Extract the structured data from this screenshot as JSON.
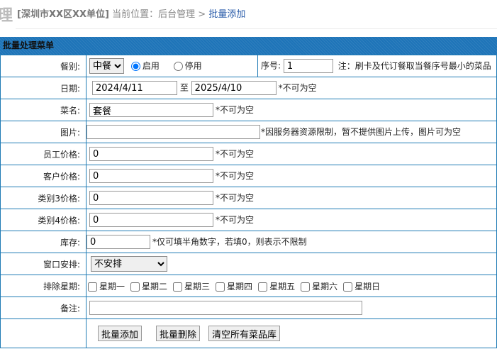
{
  "header": {
    "logo": "理",
    "org": "[深圳市XX区XX单位]",
    "location_label": "当前位置：",
    "path": "后台管理 >",
    "current": "批量添加"
  },
  "panel_title": "批量处理菜单",
  "meal": {
    "label": "餐别:",
    "value": "中餐",
    "enable": "启用",
    "disable": "停用",
    "seq_label": "序号:",
    "seq_value": "1",
    "seq_note": "注：刷卡及代订餐取当餐序号最小的菜品"
  },
  "date": {
    "label": "日期:",
    "from": "2024/4/11",
    "to_label": "至",
    "to": "2025/4/10",
    "note": "*不可为空"
  },
  "name": {
    "label": "菜名:",
    "value": "套餐",
    "note": "*不可为空"
  },
  "image": {
    "label": "图片:",
    "value": "",
    "note": "*因服务器资源限制，暂不提供图片上传，图片可为空"
  },
  "prices": [
    {
      "label": "员工价格:",
      "value": "0",
      "note": "*不可为空"
    },
    {
      "label": "客户价格:",
      "value": "0",
      "note": "*不可为空"
    },
    {
      "label": "类别3价格:",
      "value": "0",
      "note": "*不可为空"
    },
    {
      "label": "类别4价格:",
      "value": "0",
      "note": "*不可为空"
    }
  ],
  "stock": {
    "label": "库存:",
    "value": "0",
    "note": "*仅可填半角数字，若填0，则表示不限制"
  },
  "window": {
    "label": "窗口安排:",
    "value": "不安排"
  },
  "exclude": {
    "label": "排除星期:",
    "days": [
      "星期一",
      "星期二",
      "星期三",
      "星期四",
      "星期五",
      "星期六",
      "星期日"
    ]
  },
  "remark": {
    "label": "备注:",
    "value": ""
  },
  "buttons": {
    "add": "批量添加",
    "delete": "批量删除",
    "clear": "清空所有菜品库"
  }
}
